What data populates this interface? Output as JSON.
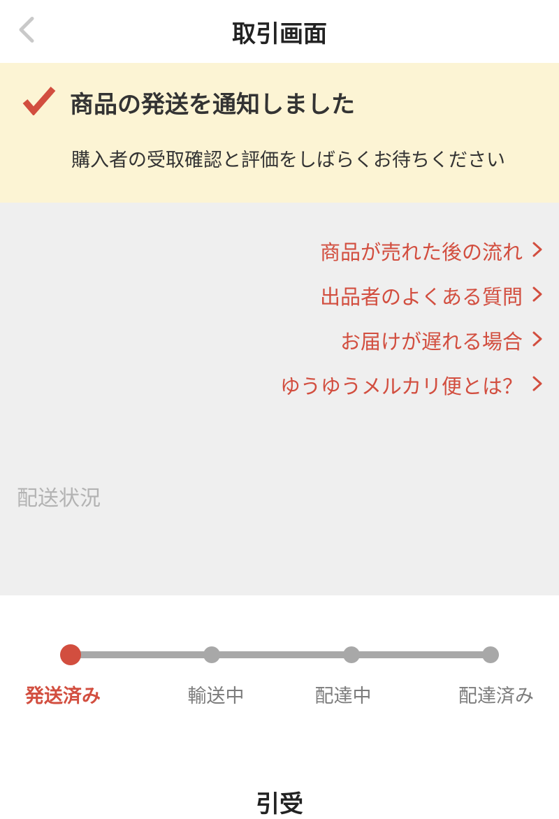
{
  "header": {
    "title": "取引画面"
  },
  "notice": {
    "title": "商品の発送を通知しました",
    "subtitle": "購入者の受取確認と評価をしばらくお待ちください"
  },
  "links": [
    "商品が売れた後の流れ",
    "出品者のよくある質問",
    "お届けが遅れる場合",
    "ゆうゆうメルカリ便とは？"
  ],
  "delivery": {
    "section_label": "配送状況",
    "steps": [
      "発送済み",
      "輸送中",
      "配達中",
      "配達済み"
    ],
    "active_index": 0
  },
  "bottom_title": "引受",
  "colors": {
    "accent": "#d24e3f",
    "notice_bg": "#fcf4d4",
    "gray_bg": "#efefef",
    "muted": "#a8a8a8"
  }
}
